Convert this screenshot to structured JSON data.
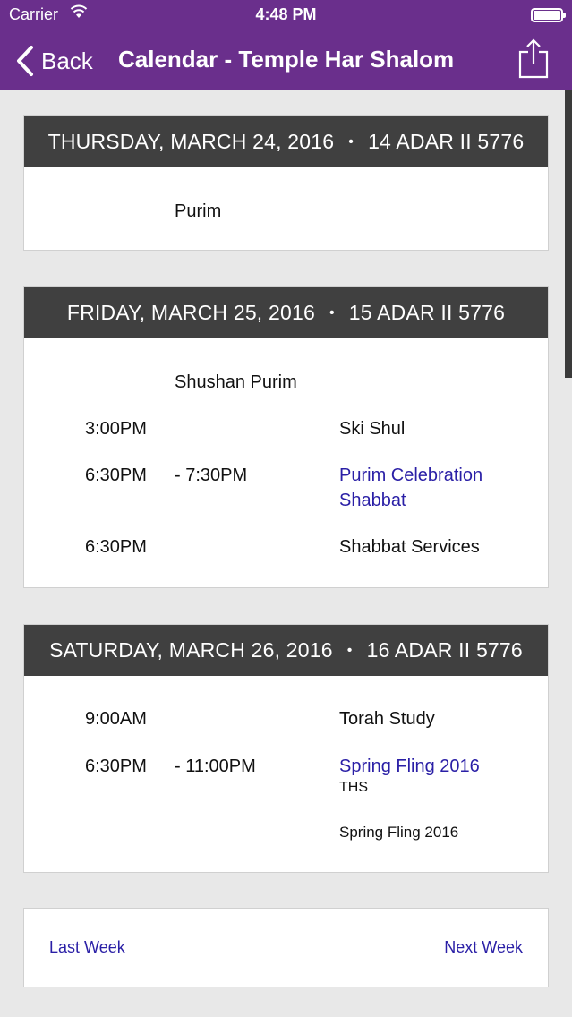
{
  "status": {
    "carrier": "Carrier",
    "time": "4:48 PM"
  },
  "nav": {
    "back_label": "Back",
    "title": "Calendar - Temple Har Shalom"
  },
  "colors": {
    "brand": "#6a2f8c",
    "header": "#404040",
    "link": "#2a1fa6"
  },
  "days": [
    {
      "date": "THURSDAY, MARCH 24, 2016",
      "separator": "•",
      "hebrew": "14 ADAR II 5776",
      "holiday": "Purim"
    },
    {
      "date": "FRIDAY, MARCH 25, 2016",
      "separator": "•",
      "hebrew": "15 ADAR II 5776",
      "holiday": "Shushan Purim",
      "events": [
        {
          "start": "3:00PM",
          "end": "",
          "title": "Ski Shul"
        },
        {
          "start": "6:30PM",
          "end": "- 7:30PM",
          "title_line1": "Purim Celebration",
          "title_line2": "Shabbat"
        },
        {
          "start": "6:30PM",
          "end": "",
          "title": "Shabbat Services"
        }
      ]
    },
    {
      "date": "SATURDAY, MARCH 26, 2016",
      "separator": "•",
      "hebrew": "16 ADAR II 5776",
      "events": [
        {
          "start": "9:00AM",
          "end": "",
          "title": "Torah Study"
        },
        {
          "start": "6:30PM",
          "end": "- 11:00PM",
          "title": "Spring Fling 2016",
          "location": "THS",
          "description": "Spring Fling 2016"
        }
      ]
    }
  ],
  "pager": {
    "last_week": "Last Week",
    "next_week": "Next Week"
  }
}
